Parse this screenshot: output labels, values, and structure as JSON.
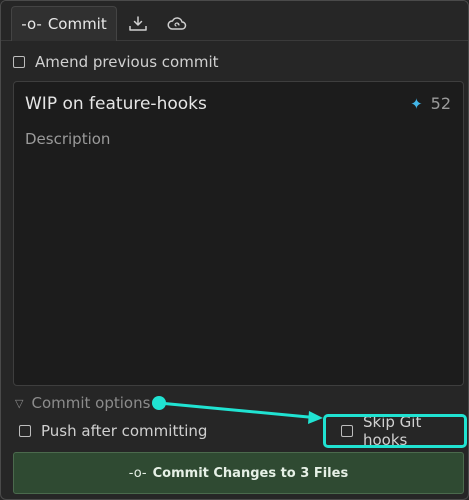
{
  "tabs": {
    "commit": {
      "glyph": "-o-",
      "label": "Commit"
    },
    "fetch_icon": "download-tray-icon",
    "cloud_icon": "cloud-sync-icon"
  },
  "amend": {
    "label": "Amend previous commit",
    "checked": false
  },
  "message": {
    "summary": "WIP on feature-hooks",
    "ai_icon": "sparkle-icon",
    "char_count": "52",
    "description_placeholder": "Description"
  },
  "options": {
    "toggle_label": "Commit options",
    "expanded": false,
    "push_after": {
      "label": "Push after committing",
      "checked": false
    },
    "skip_hooks": {
      "label": "Skip Git hooks",
      "checked": false
    }
  },
  "commit_button": {
    "glyph": "-o-",
    "label": "Commit Changes to 3 Files"
  },
  "colors": {
    "background": "#262626",
    "input_bg": "#1c1c1c",
    "highlight": "#20e3d2",
    "commit_button_bg": "#2f4a32",
    "sparkle": "#42b6e8"
  }
}
